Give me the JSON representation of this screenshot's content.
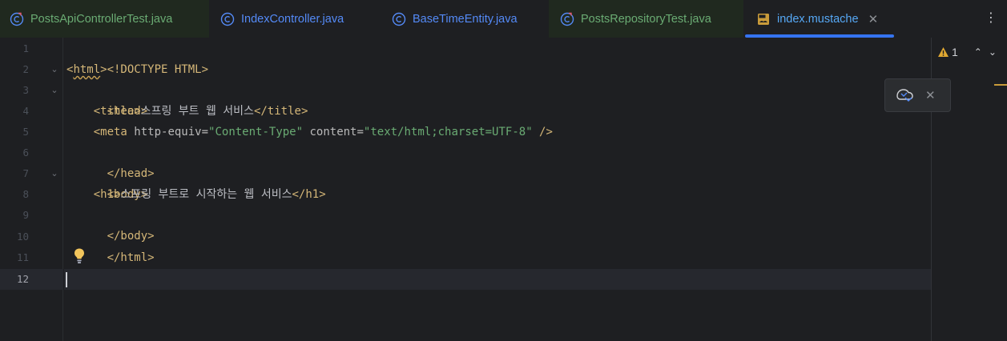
{
  "tabs": [
    {
      "label": "PostsApiControllerTest.java",
      "kind": "test-class",
      "active": false
    },
    {
      "label": "IndexController.java",
      "kind": "class",
      "active": false
    },
    {
      "label": "BaseTimeEntity.java",
      "kind": "class",
      "active": false
    },
    {
      "label": "PostsRepositoryTest.java",
      "kind": "test-class",
      "active": false
    },
    {
      "label": "index.mustache",
      "kind": "mustache",
      "active": true
    }
  ],
  "tab_close_glyph": "✕",
  "more_glyph": "⋮",
  "inspection": {
    "warnings": "1",
    "up_glyph": "⌃",
    "down_glyph": "⌄"
  },
  "popup": {
    "icon": "load-changes-icon",
    "close_glyph": "✕"
  },
  "gutter": {
    "lines": [
      "1",
      "2",
      "3",
      "4",
      "5",
      "6",
      "7",
      "8",
      "9",
      "10",
      "11",
      "12"
    ],
    "current_line": "12",
    "fold_glyph": "⌄"
  },
  "code": {
    "l1": "<!DOCTYPE HTML>",
    "l2_open": "<",
    "l2_tag": "html",
    "l2_close": ">",
    "l3": "<head>",
    "l4_indent": "    ",
    "l4_open": "<title>",
    "l4_text": "스프링 부트 웹 서비스",
    "l4_close": "</title>",
    "l5_indent": "    ",
    "l5_tag": "<meta",
    "l5_attr1": " http-equiv=",
    "l5_val1": "\"Content-Type\"",
    "l5_attr2": " content=",
    "l5_val2": "\"text/html;charset=UTF-8\"",
    "l5_end": " />",
    "l6": "</head>",
    "l7": "<body>",
    "l8_indent": "    ",
    "l8_open": "<h1>",
    "l8_text": "스프링 부트로 시작하는 웹 서비스",
    "l8_close": "</h1>",
    "l9": "</body>",
    "l10": "</html>",
    "l11": "",
    "l12": ""
  },
  "colors": {
    "background": "#1e1f22",
    "tag": "#d5b778",
    "string": "#6aab73",
    "text": "#bcbec4",
    "test_tab": "#6aab73",
    "active_tab_underline": "#3574f0",
    "warning": "#e0a832"
  }
}
